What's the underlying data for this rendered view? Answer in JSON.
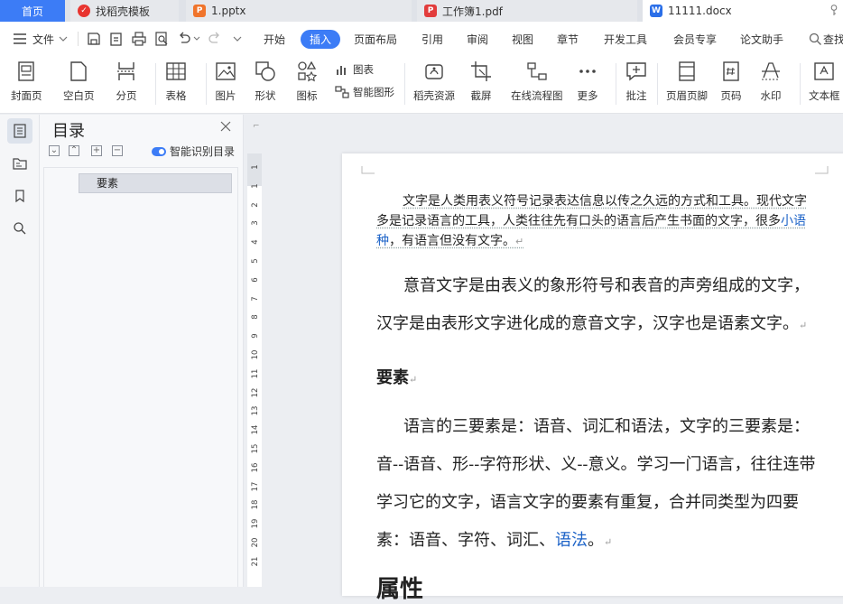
{
  "tabs": [
    {
      "label": "首页"
    },
    {
      "label": "找稻壳模板"
    },
    {
      "label": "1.pptx"
    },
    {
      "label": "工作簿1.pdf"
    },
    {
      "label": "11111.docx"
    }
  ],
  "menu": {
    "file_label": "文件",
    "items": [
      "开始",
      "插入",
      "页面布局",
      "引用",
      "审阅",
      "视图",
      "章节",
      "开发工具",
      "会员专享",
      "论文助手"
    ],
    "active": "插入",
    "search_label": "查找"
  },
  "ribbon": {
    "cover": "封面页",
    "blank": "空白页",
    "pagebreak": "分页",
    "table": "表格",
    "picture": "图片",
    "shape": "形状",
    "icon": "图标",
    "chart": "图表",
    "smartart": "智能图形",
    "docer": "稻壳资源",
    "screenshot": "截屏",
    "flowchart": "在线流程图",
    "more": "更多",
    "comment": "批注",
    "headerfooter": "页眉页脚",
    "pagenum": "页码",
    "watermark": "水印",
    "textbox": "文本框"
  },
  "toc": {
    "title": "目录",
    "smart_label": "智能识别目录",
    "items": [
      "要素"
    ]
  },
  "ruler": {
    "numbers": [
      "1",
      "1",
      "2",
      "3",
      "4",
      "5",
      "6",
      "7",
      "8",
      "9",
      "10",
      "11",
      "12",
      "13",
      "14",
      "15",
      "16",
      "17",
      "18",
      "19",
      "20",
      "21"
    ]
  },
  "document": {
    "p1_a": "文字是人类用表义符号记录表达信息以传之久远的方式和工具。现代文字多是记录语言的工具，人类往往先有口头的语言后产生书面的文字，很多",
    "p1_link": "小语种",
    "p1_b": "，有语言但没有文字。",
    "p2": "意音文字是由表义的象形符号和表音的声旁组成的文字，汉字是由表形文字进化成的意音文字，汉字也是语素文字。",
    "heading1": "要素",
    "p3_a": "语言的三要素是：语音、词汇和语法，文字的三要素是：音--语音、形--字符形状、义--意义。学习一门语言，往往连带学习它的文字，语言文字的要素有重复，合并同类型为四要素：语音、字符、词汇、",
    "p3_link": "语法",
    "p3_b": "。",
    "heading2": "属性",
    "paragraph_mark": "↵"
  }
}
